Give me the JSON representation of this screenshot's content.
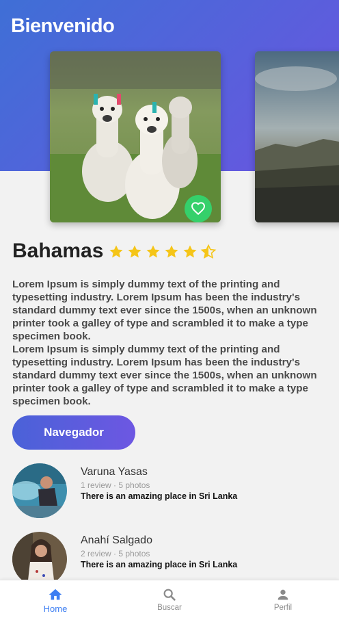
{
  "header": {
    "title": "Bienvenido"
  },
  "colors": {
    "accent": "#5b5fe0",
    "favorite": "#35d06b",
    "star": "#f5c518",
    "nav_active": "#3d7ef2"
  },
  "cards": [
    {
      "image": "alpacas-photo",
      "favorite_icon": "heart-icon"
    },
    {
      "image": "landscape-photo"
    }
  ],
  "place": {
    "title": "Bahamas",
    "rating": 5.5,
    "rating_max": 6,
    "description": [
      "Lorem Ipsum is simply dummy text of the printing and typesetting industry. Lorem Ipsum has been the industry's standard dummy text ever since the 1500s, when an unknown printer took a galley of type and scrambled it to make a type specimen book.",
      "Lorem Ipsum is simply dummy text of the printing and typesetting industry. Lorem Ipsum has been the industry's standard dummy text ever since the 1500s, when an unknown printer took a galley of type and scrambled it to make a type specimen book."
    ]
  },
  "actions": {
    "navigate_label": "Navegador"
  },
  "reviews": [
    {
      "name": "Varuna Yasas",
      "meta": "1 review · 5 photos",
      "text": "There is an amazing place in Sri Lanka"
    },
    {
      "name": "Anahí Salgado",
      "meta": "2 review · 5 photos",
      "text": "There is an amazing place in Sri Lanka"
    }
  ],
  "bottom_nav": [
    {
      "label": "Home",
      "icon": "home-icon",
      "active": true
    },
    {
      "label": "Buscar",
      "icon": "search-icon",
      "active": false
    },
    {
      "label": "Perfil",
      "icon": "person-icon",
      "active": false
    }
  ]
}
